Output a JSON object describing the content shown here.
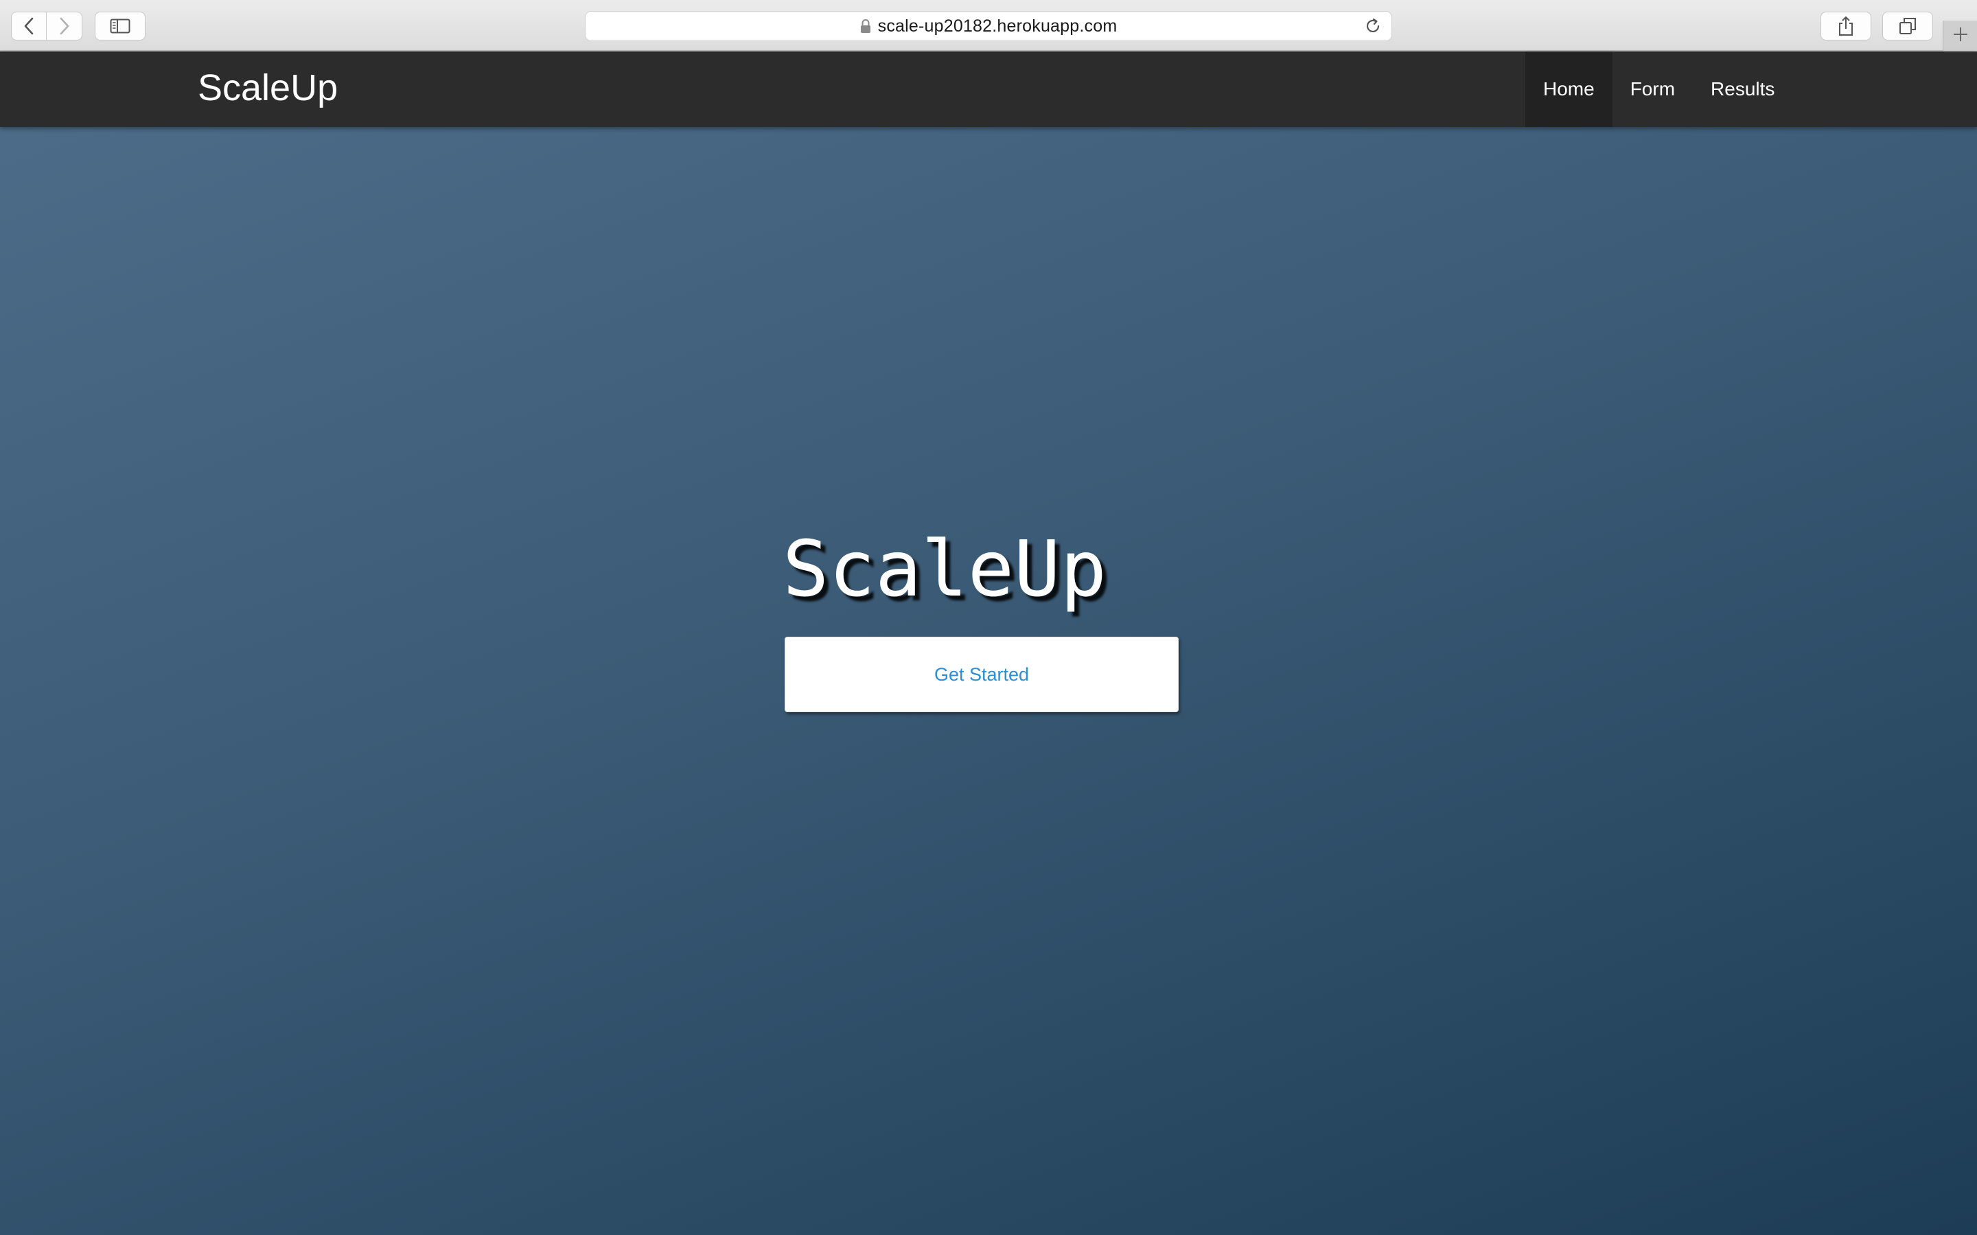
{
  "browser": {
    "url": "scale-up20182.herokuapp.com",
    "icons": {
      "back": "chevron-left-icon",
      "forward": "chevron-right-icon",
      "sidebar": "sidebar-icon",
      "lock": "lock-icon",
      "reload": "reload-icon",
      "share": "share-icon",
      "tabs": "tabs-icon",
      "new_tab": "plus-icon"
    }
  },
  "navbar": {
    "brand": "ScaleUp",
    "links": [
      {
        "label": "Home",
        "active": true
      },
      {
        "label": "Form",
        "active": false
      },
      {
        "label": "Results",
        "active": false
      }
    ]
  },
  "hero": {
    "title": "ScaleUp",
    "cta_label": "Get Started"
  },
  "colors": {
    "navbar_bg": "#2c2c2c",
    "hero_gradient_start": "#4d6d8a",
    "hero_gradient_end": "#1d3c55",
    "cta_text": "#2a8fd4"
  }
}
